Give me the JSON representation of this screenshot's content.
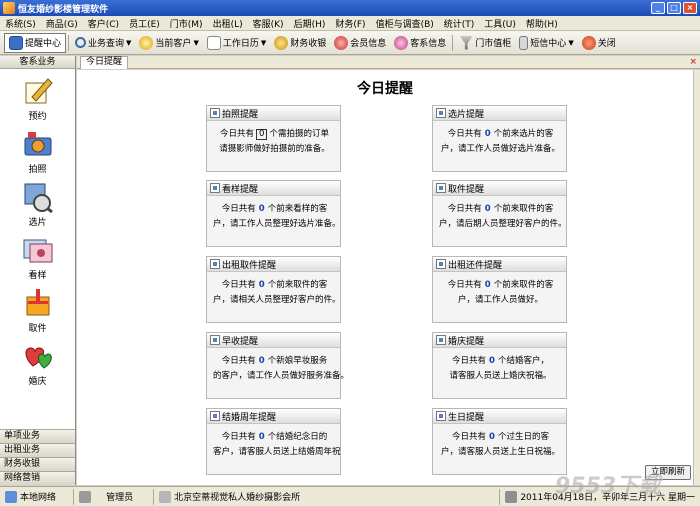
{
  "window": {
    "title": "恒友婚纱影楼管理软件"
  },
  "menu": [
    "系统(S)",
    "商品(G)",
    "客户(C)",
    "员工(E)",
    "门市(M)",
    "出租(L)",
    "客服(K)",
    "后期(H)",
    "财务(F)",
    "值柜与调查(B)",
    "统计(T)",
    "工具(U)",
    "帮助(H)"
  ],
  "toolbar": {
    "reminder": "提醒中心",
    "business_query": "业务查询",
    "current_customer": "当前客户",
    "work_calendar": "工作日历",
    "finance": "财务收银",
    "member": "会员信息",
    "service": "客系信息",
    "store_cabinet": "门市值柜",
    "sms": "短信中心",
    "close": "关闭"
  },
  "left_panel": {
    "header": "客系业务",
    "items": [
      {
        "label": "预约",
        "icon": "appointment-icon"
      },
      {
        "label": "拍照",
        "icon": "camera-icon"
      },
      {
        "label": "选片",
        "icon": "photo-select-icon"
      },
      {
        "label": "看样",
        "icon": "sample-icon"
      },
      {
        "label": "取件",
        "icon": "pickup-icon"
      },
      {
        "label": "婚庆",
        "icon": "wedding-icon"
      }
    ],
    "bottom_tabs": [
      "单项业务",
      "出租业务",
      "财务收银",
      "网络营销"
    ]
  },
  "doc_tab": "今日提醒",
  "page_title": "今日提醒",
  "cards": [
    {
      "title": "拍照提醒",
      "pre": "今日共有",
      "count": "0",
      "line1": "个需拍摄的订单",
      "line2": "请摄影师做好拍摄前的准备。",
      "boxed": true
    },
    {
      "title": "选片提醒",
      "pre": "今日共有",
      "count": "0",
      "line1": "个前来选片的客",
      "line2": "户，请工作人员做好选片准备。",
      "boxed": false
    },
    {
      "title": "看样提醒",
      "pre": "今日共有",
      "count": "0",
      "line1": "个前来看样的客",
      "line2": "户，请工作人员整理好选片准备。",
      "boxed": false
    },
    {
      "title": "取件提醒",
      "pre": "今日共有",
      "count": "0",
      "line1": "个前来取件的客",
      "line2": "户，请后期人员整理好客户的件。",
      "boxed": false
    },
    {
      "title": "出租取件提醒",
      "pre": "今日共有",
      "count": "0",
      "line1": "个前来取件的客",
      "line2": "户，请相关人员整理好客户的件。",
      "boxed": false
    },
    {
      "title": "出租还件提醒",
      "pre": "今日共有",
      "count": "0",
      "line1": "个前来取件的客",
      "line2": "户，请工作人员做好。",
      "boxed": false
    },
    {
      "title": "早收提醒",
      "pre": "今日共有",
      "count": "0",
      "line1": "个新娘早妆服务",
      "line2": "的客户，请工作人员做好服务准备。",
      "boxed": false
    },
    {
      "title": "婚庆提醒",
      "pre": "今日共有",
      "count": "0",
      "line1": "个结婚客户，",
      "line2": "请客服人员送上婚庆祝福。",
      "boxed": false
    },
    {
      "title": "结婚周年提醒",
      "pre": "今日共有",
      "count": "0",
      "line1": "个结婚纪念日的",
      "line2": "客户，请客服人员送上结婚周年祝",
      "boxed": false
    },
    {
      "title": "生日提醒",
      "pre": "今日共有",
      "count": "0",
      "line1": "个过生日的客",
      "line2": "户，请客服人员送上生日祝福。",
      "boxed": false
    }
  ],
  "refresh": "立即刷新",
  "status": {
    "network": "本地网络",
    "user": "管理员",
    "company": "北京空蒂视觉私人婚纱摄影会所",
    "date": "2011年04月18日，辛卯年三月十六 星期一"
  },
  "watermark": "9553下载"
}
